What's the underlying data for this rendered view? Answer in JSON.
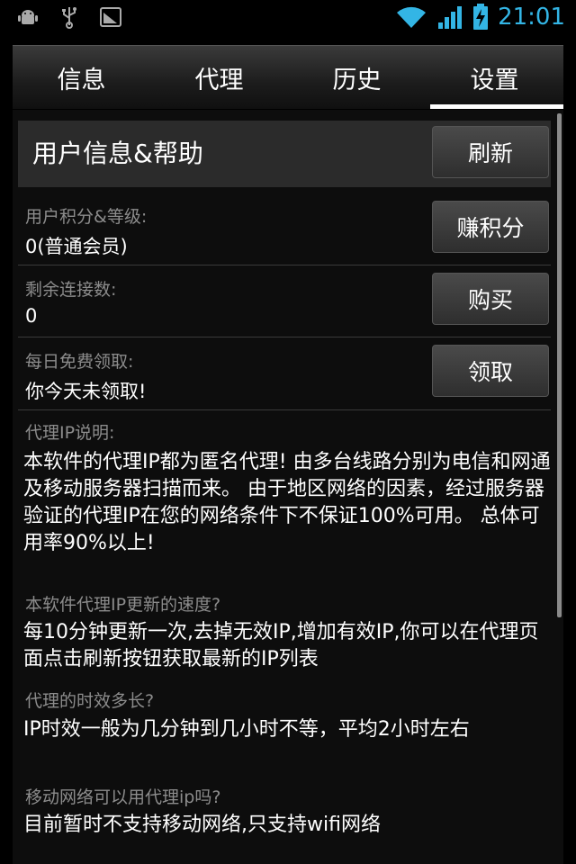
{
  "status_bar": {
    "left_icons": [
      "android-debug-icon",
      "usb-icon",
      "screenshot-icon"
    ],
    "right_icons": [
      "wifi-icon",
      "signal-icon",
      "battery-charging-icon"
    ],
    "time": "21:01",
    "accent_color": "#33b5e5"
  },
  "tabs": [
    {
      "label": "信息",
      "active": false
    },
    {
      "label": "代理",
      "active": false
    },
    {
      "label": "历史",
      "active": false
    },
    {
      "label": "设置",
      "active": true
    }
  ],
  "header": {
    "title": "用户信息&帮助",
    "refresh_label": "刷新"
  },
  "rows": [
    {
      "label": "用户积分&等级:",
      "value": "0(普通会员)",
      "button": "赚积分"
    },
    {
      "label": "剩余连接数:",
      "value": "0",
      "button": "购买"
    },
    {
      "label": "每日免费领取:",
      "value": "你今天未领取!",
      "button": "领取"
    }
  ],
  "faq": [
    {
      "question": "代理IP说明:",
      "answer": "本软件的代理IP都为匿名代理! 由多台线路分别为电信和网通及移动服务器扫描而来。 由于地区网络的因素，经过服务器验证的代理IP在您的网络条件下不保证100%可用。 总体可用率90%以上!"
    },
    {
      "question": "本软件代理IP更新的速度?",
      "answer": "每10分钟更新一次,去掉无效IP,增加有效IP,你可以在代理页面点击刷新按钮获取最新的IP列表"
    },
    {
      "question": "代理的时效多长?",
      "answer": "IP时效一般为几分钟到几小时不等，平均2小时左右"
    },
    {
      "question": "移动网络可以用代理ip吗?",
      "answer": "目前暂时不支持移动网络,只支持wifi网络"
    }
  ]
}
